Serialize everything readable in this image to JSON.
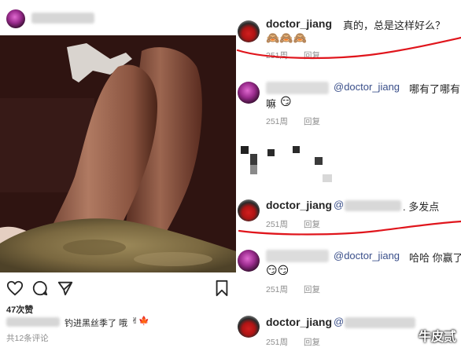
{
  "post": {
    "likes": "47次赞",
    "caption_text": "钓进黑丝季了 哦",
    "caption_emojis": "✌🍁",
    "view_comments": "共12条评论"
  },
  "comments": [
    {
      "username": "doctor_jiang",
      "text": "真的，总是这样好么？",
      "emojis": "🙈🙈🙈",
      "time": "251周",
      "reply": "回复"
    },
    {
      "mention": "@doctor_jiang",
      "text": "哪有了哪有",
      "text2": "嘛",
      "emoji": "😏",
      "time": "251周",
      "reply": "回复"
    },
    {
      "username": "doctor_jiang",
      "mention": "@",
      "text": ". 多发点",
      "time": "251周",
      "reply": "回复"
    },
    {
      "mention": "@doctor_jiang",
      "text": "哈哈 你赢了",
      "emojis": "😏😏",
      "time": "251周",
      "reply": "回复"
    },
    {
      "username": "doctor_jiang",
      "mention": "@",
      "time": "251周",
      "reply": "回复"
    }
  ],
  "watermark": "牛皮贰",
  "colors": {
    "annotation_red": "#e0151c",
    "mention_blue": "#3a4f8a",
    "meta_gray": "#8e8e8e"
  }
}
